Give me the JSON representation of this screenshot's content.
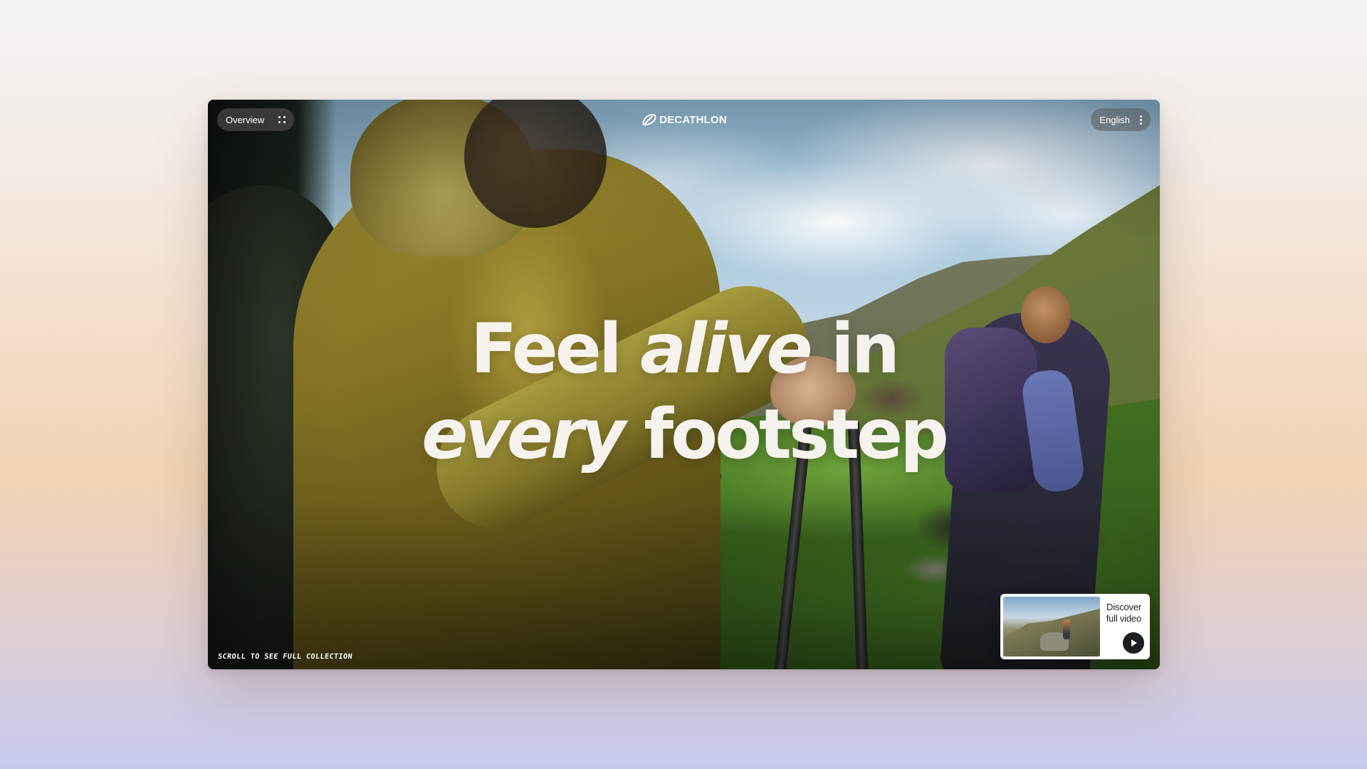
{
  "nav": {
    "overview_label": "Overview",
    "overview_icon": "grid-dots-icon",
    "language_label": "English",
    "language_icon": "more-vertical-icon"
  },
  "brand": {
    "name": "DECATHLON",
    "logo_icon": "decathlon-swoosh-icon"
  },
  "hero": {
    "headline_line1_a": "Feel ",
    "headline_line1_em": "alive",
    "headline_line1_b": " in",
    "headline_line2_em": "every",
    "headline_line2_b": " footstep",
    "scroll_hint": "Scroll to see full collection"
  },
  "video_card": {
    "label_line1": "Discover",
    "label_line2": "full video",
    "play_icon": "play-icon"
  },
  "colors": {
    "pill_bg": "#5a5a5a",
    "headline_text": "#f6f3ee",
    "card_bg": "#ffffff",
    "play_button": "#1d1d1d"
  }
}
